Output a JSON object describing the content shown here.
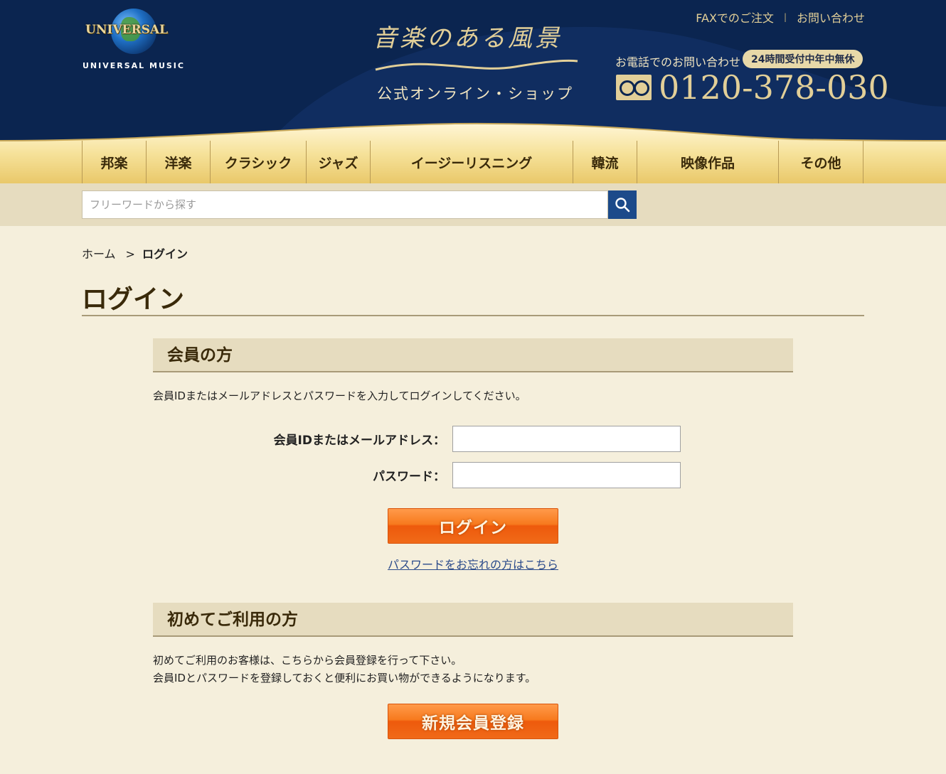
{
  "header": {
    "logo_word": "UNIVERSAL",
    "logo_sub": "UNIVERSAL MUSIC",
    "brand_title": "音楽のある風景",
    "brand_sub": "公式オンライン・ショップ",
    "top_links": [
      "FAXでのご注文",
      "お問い合わせ"
    ],
    "phone_label": "お電話でのお問い合わせ",
    "phone_badge": "24時間受付中年中無休",
    "phone_number": "0120-378-030"
  },
  "nav": {
    "items": [
      "邦楽",
      "洋楽",
      "クラシック",
      "ジャズ",
      "イージーリスニング",
      "韓流",
      "映像作品",
      "その他"
    ]
  },
  "search": {
    "placeholder": "フリーワードから探す"
  },
  "breadcrumb": {
    "home": "ホーム",
    "separator": ">",
    "current": "ログイン"
  },
  "page_title": "ログイン",
  "member": {
    "heading": "会員の方",
    "instruction": "会員IDまたはメールアドレスとパスワードを入力してログインしてください。",
    "id_label": "会員IDまたはメールアドレス：",
    "password_label": "パスワード：",
    "login_button": "ログイン",
    "forgot_link": "パスワードをお忘れの方はこちら"
  },
  "newuser": {
    "heading": "初めてご利用の方",
    "line1": "初めてご利用のお客様は、こちらから会員登録を行って下さい。",
    "line2": "会員IDとパスワードを登録しておくと便利にお買い物ができるようになります。",
    "register_button": "新規会員登録"
  }
}
